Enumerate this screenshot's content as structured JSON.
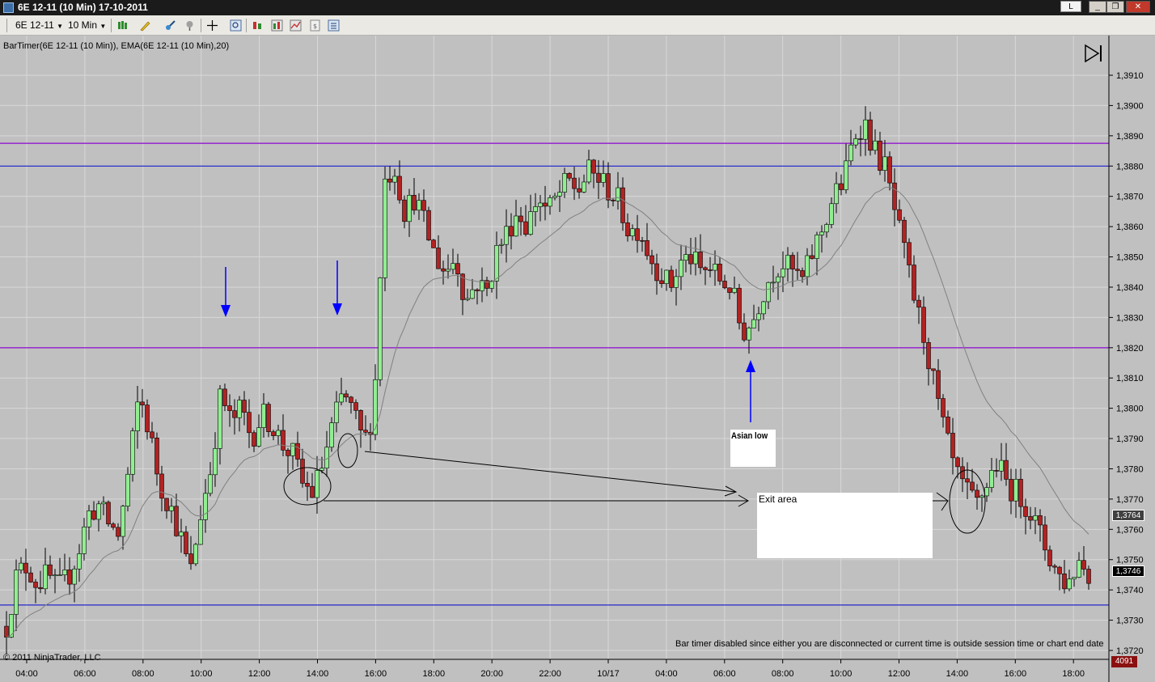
{
  "window": {
    "title": "6E 12-11 (10 Min)  17-10-2011",
    "l_button": "L",
    "minimize": "_",
    "restore": "❐",
    "close": "✕"
  },
  "toolbar": {
    "instrument": "6E 12-11",
    "interval": "10 Min",
    "icons": [
      "bar-type-icon",
      "draw-pencil-icon",
      "draw-tools-icon",
      "pin-icon",
      "crosshair-icon",
      "zoom-icon",
      "chart-style-icon",
      "indicators-icon",
      "strategies-icon",
      "data-box-icon",
      "properties-icon"
    ]
  },
  "overlay_label": "BarTimer(6E 12-11 (10 Min)), EMA(6E 12-11 (10 Min),20)",
  "copyright": "© 2011 NinjaTrader, LLC",
  "status_message": "Bar timer disabled since either you are disconnected or current time is outside session time or chart end date",
  "annotations": {
    "asian_low": "Asian low",
    "exit_area": "Exit area"
  },
  "price_badges": {
    "ema": "1,3764",
    "last": "1,3746",
    "bar_count": "4091"
  },
  "colors": {
    "background": "#c0c0c0",
    "up_candle": "#90ee90",
    "down_candle": "#b22222",
    "ema_line": "#808080",
    "purple_line": "#9932cc",
    "blue_line": "#0000cd",
    "arrow": "#0000ff"
  },
  "chart_data": {
    "type": "candlestick",
    "xlabel": "",
    "ylabel": "",
    "ylim": [
      1.3715,
      1.3925
    ],
    "y_ticks": [
      "1,3720",
      "1,3730",
      "1,3740",
      "1,3750",
      "1,3760",
      "1,3770",
      "1,3780",
      "1,3790",
      "1,3800",
      "1,3810",
      "1,3820",
      "1,3830",
      "1,3840",
      "1,3850",
      "1,3860",
      "1,3870",
      "1,3880",
      "1,3890",
      "1,3900",
      "1,3910"
    ],
    "y_tick_values": [
      1.372,
      1.373,
      1.374,
      1.375,
      1.376,
      1.377,
      1.378,
      1.379,
      1.38,
      1.381,
      1.382,
      1.383,
      1.384,
      1.385,
      1.386,
      1.387,
      1.388,
      1.389,
      1.39,
      1.391
    ],
    "x_ticks": [
      "04:00",
      "06:00",
      "08:00",
      "10:00",
      "12:00",
      "14:00",
      "16:00",
      "18:00",
      "20:00",
      "22:00",
      "10/17",
      "04:00",
      "06:00",
      "08:00",
      "10:00",
      "12:00",
      "14:00",
      "16:00",
      "18:00"
    ],
    "horizontal_lines": [
      {
        "price": 1.38875,
        "color": "purple"
      },
      {
        "price": 1.388,
        "color": "blue"
      },
      {
        "price": 1.382,
        "color": "purple"
      },
      {
        "price": 1.3735,
        "color": "blue"
      }
    ],
    "series": [
      {
        "name": "6E 12-11 (10 Min)",
        "type": "candlestick",
        "close_path": [
          1.3728,
          1.3745,
          1.3748,
          1.3742,
          1.3745,
          1.374,
          1.3744,
          1.3752,
          1.3765,
          1.3768,
          1.3762,
          1.3758,
          1.378,
          1.3805,
          1.3792,
          1.3775,
          1.3768,
          1.3758,
          1.3745,
          1.3765,
          1.378,
          1.3805,
          1.3795,
          1.38,
          1.379,
          1.3798,
          1.3795,
          1.3788,
          1.3785,
          1.3775,
          1.3772,
          1.3782,
          1.3795,
          1.3805,
          1.3798,
          1.3788,
          1.38,
          1.3875,
          1.388,
          1.3865,
          1.387,
          1.386,
          1.385,
          1.3845,
          1.385,
          1.3835,
          1.3842,
          1.3838,
          1.3852,
          1.3858,
          1.3865,
          1.386,
          1.387,
          1.3865,
          1.387,
          1.3875,
          1.3872,
          1.3878,
          1.3876,
          1.3872,
          1.3868,
          1.3858,
          1.386,
          1.385,
          1.3845,
          1.384,
          1.3848,
          1.385,
          1.3845,
          1.3846,
          1.3842,
          1.384,
          1.3825,
          1.3828,
          1.3838,
          1.3845,
          1.3848,
          1.3845,
          1.3842,
          1.3852,
          1.386,
          1.387,
          1.3875,
          1.389,
          1.3895,
          1.3885,
          1.388,
          1.3865,
          1.385,
          1.3835,
          1.3822,
          1.3805,
          1.379,
          1.3778,
          1.3772,
          1.3768,
          1.3775,
          1.3782,
          1.3775,
          1.3772,
          1.3768,
          1.376,
          1.3752,
          1.3745,
          1.3742,
          1.375,
          1.3746
        ],
        "last": 1.3746
      },
      {
        "name": "EMA(6E 12-11 (10 Min),20)",
        "type": "line",
        "last": 1.3764
      }
    ]
  }
}
